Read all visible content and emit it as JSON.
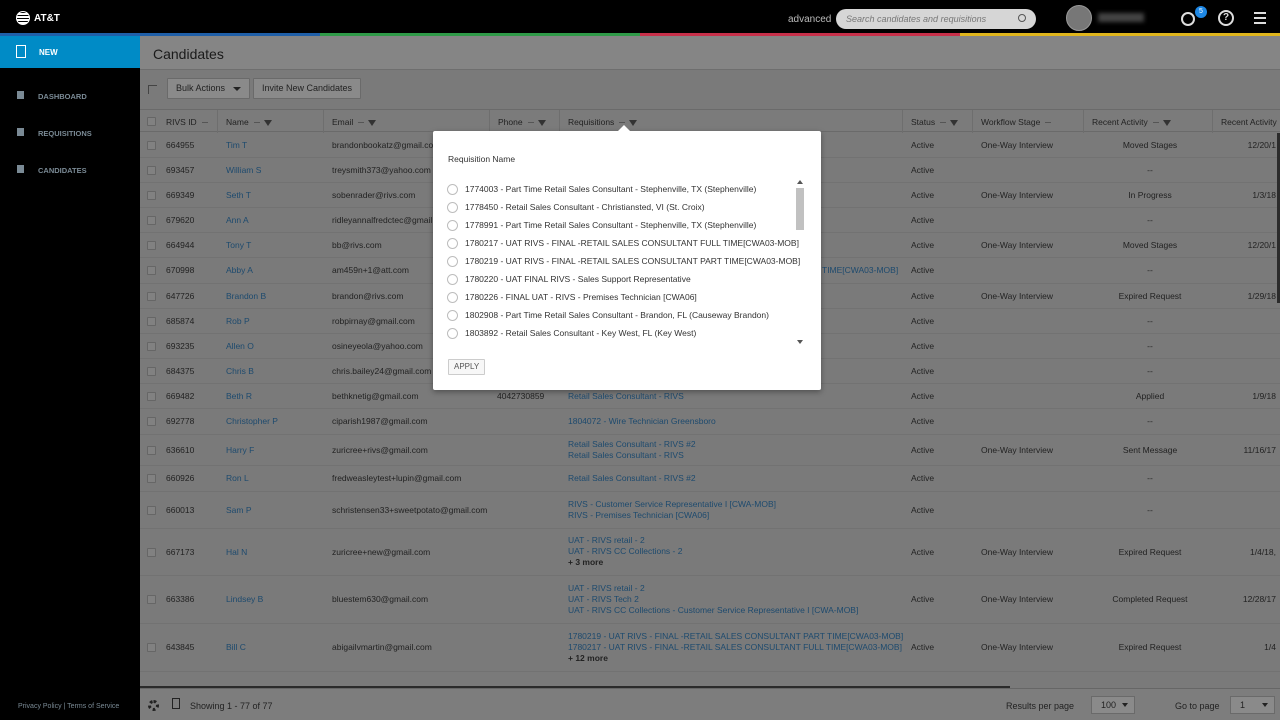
{
  "brand": {
    "name": "AT&T"
  },
  "header": {
    "advanced_label": "advanced",
    "search_placeholder": "Search candidates and requisitions",
    "user_name": "ANGELA",
    "notification_count": "5",
    "strip_colors": [
      "#1f5fa8",
      "#2f9a48",
      "#c8304a",
      "#e0b51c"
    ]
  },
  "sidebar": {
    "items": [
      {
        "label": "NEW",
        "icon": "new-document-icon"
      },
      {
        "label": "DASHBOARD",
        "icon": "bar-chart-icon"
      },
      {
        "label": "REQUISITIONS",
        "icon": "document-stack-icon"
      },
      {
        "label": "CANDIDATES",
        "icon": "person-card-icon"
      }
    ],
    "footer_privacy": "Privacy Policy",
    "footer_sep": " | ",
    "footer_terms": "Terms of Service"
  },
  "page": {
    "title": "Candidates"
  },
  "toolbar": {
    "bulk_actions": "Bulk Actions",
    "invite": "Invite New Candidates"
  },
  "table": {
    "columns": [
      "RIVS ID",
      "Name",
      "Email",
      "Phone",
      "Requisitions",
      "Status",
      "Workflow Stage",
      "Recent Activity",
      "Recent Activity"
    ],
    "rows": [
      {
        "id": "664955",
        "name": "Tim T",
        "email": "brandonbookatz@gmail.com",
        "phone": "",
        "reqs": [],
        "more": "",
        "status": "Active",
        "stage": "One-Way Interview",
        "activity": "Moved Stages",
        "date": "12/20/1"
      },
      {
        "id": "693457",
        "name": "William S",
        "email": "treysmith373@yahoo.com",
        "phone": "",
        "reqs": [],
        "more": "",
        "status": "Active",
        "stage": "",
        "activity": "--",
        "date": ""
      },
      {
        "id": "669349",
        "name": "Seth T",
        "email": "sobenrader@rivs.com",
        "phone": "",
        "reqs": [],
        "more": "",
        "status": "Active",
        "stage": "One-Way Interview",
        "activity": "In Progress",
        "date": "1/3/18"
      },
      {
        "id": "679620",
        "name": "Ann A",
        "email": "ridleyannalfredctec@gmail.com",
        "phone": "",
        "reqs": [],
        "more": "",
        "status": "Active",
        "stage": "",
        "activity": "--",
        "date": ""
      },
      {
        "id": "664944",
        "name": "Tony T",
        "email": "bb@rivs.com",
        "phone": "",
        "reqs": [],
        "more": "",
        "status": "Active",
        "stage": "One-Way Interview",
        "activity": "Moved Stages",
        "date": "12/20/1"
      },
      {
        "id": "670998",
        "name": "Abby A",
        "email": "am459n+1@att.com",
        "phone": "",
        "reqs": [
          "TIME[CWA03-MOB]"
        ],
        "more": "",
        "status": "Active",
        "stage": "",
        "activity": "--",
        "date": ""
      },
      {
        "id": "647726",
        "name": "Brandon B",
        "email": "brandon@rivs.com",
        "phone": "",
        "reqs": [],
        "more": "",
        "status": "Active",
        "stage": "One-Way Interview",
        "activity": "Expired Request",
        "date": "1/29/18"
      },
      {
        "id": "685874",
        "name": "Rob P",
        "email": "robpirnay@gmail.com",
        "phone": "",
        "reqs": [],
        "more": "",
        "status": "Active",
        "stage": "",
        "activity": "--",
        "date": ""
      },
      {
        "id": "693235",
        "name": "Allen O",
        "email": "osineyeola@yahoo.com",
        "phone": "",
        "reqs": [],
        "more": "",
        "status": "Active",
        "stage": "",
        "activity": "--",
        "date": ""
      },
      {
        "id": "684375",
        "name": "Chris B",
        "email": "chris.bailey24@gmail.com",
        "phone": "",
        "reqs": [],
        "more": "",
        "status": "Active",
        "stage": "",
        "activity": "--",
        "date": ""
      },
      {
        "id": "669482",
        "name": "Beth R",
        "email": "bethknetig@gmail.com",
        "phone": "4042730859",
        "reqs": [
          "Retail Sales Consultant - RIVS"
        ],
        "more": "",
        "status": "Active",
        "stage": "",
        "activity": "Applied",
        "date": "1/9/18"
      },
      {
        "id": "692778",
        "name": "Christopher P",
        "email": "ciparish1987@gmail.com",
        "phone": "",
        "reqs": [
          "1804072 - Wire Technician Greensboro"
        ],
        "more": "",
        "status": "Active",
        "stage": "",
        "activity": "--",
        "date": ""
      },
      {
        "id": "636610",
        "name": "Harry F",
        "email": "zuricree+rivs@gmail.com",
        "phone": "",
        "reqs": [
          "Retail Sales Consultant - RIVS #2",
          "Retail Sales Consultant - RIVS"
        ],
        "more": "",
        "status": "Active",
        "stage": "One-Way Interview",
        "activity": "Sent Message",
        "date": "11/16/17"
      },
      {
        "id": "660926",
        "name": "Ron L",
        "email": "fredweasleytest+lupin@gmail.com",
        "phone": "",
        "reqs": [
          "Retail Sales Consultant - RIVS #2"
        ],
        "more": "",
        "status": "Active",
        "stage": "",
        "activity": "--",
        "date": ""
      },
      {
        "id": "660013",
        "name": "Sam P",
        "email": "schristensen33+sweetpotato@gmail.com",
        "phone": "",
        "reqs": [
          "RIVS - Customer Service Representative I [CWA-MOB]",
          "RIVS - Premises Technician [CWA06]"
        ],
        "more": "",
        "status": "Active",
        "stage": "",
        "activity": "--",
        "date": ""
      },
      {
        "id": "667173",
        "name": "Hal N",
        "email": "zuricree+new@gmail.com",
        "phone": "",
        "reqs": [
          "UAT - RIVS retail - 2",
          "UAT - RIVS CC Collections - 2"
        ],
        "more": "+ 3 more",
        "status": "Active",
        "stage": "One-Way Interview",
        "activity": "Expired Request",
        "date": "1/4/18,"
      },
      {
        "id": "663386",
        "name": "Lindsey B",
        "email": "bluestem630@gmail.com",
        "phone": "",
        "reqs": [
          "UAT - RIVS retail - 2",
          "UAT - RIVS Tech 2",
          "UAT - RIVS CC Collections - Customer Service Representative I [CWA-MOB]"
        ],
        "more": "",
        "status": "Active",
        "stage": "One-Way Interview",
        "activity": "Completed Request",
        "date": "12/28/17"
      },
      {
        "id": "643845",
        "name": "Bill C",
        "email": "abigailvmartin@gmail.com",
        "phone": "",
        "reqs": [
          "1780219 - UAT RIVS - FINAL -RETAIL SALES CONSULTANT PART TIME[CWA03-MOB]",
          "1780217 - UAT RIVS - FINAL -RETAIL SALES CONSULTANT FULL TIME[CWA03-MOB]"
        ],
        "more": "+ 12 more",
        "status": "Active",
        "stage": "One-Way Interview",
        "activity": "Expired Request",
        "date": "1/4"
      }
    ]
  },
  "footer": {
    "showing": "Showing 1 - 77 of 77",
    "results_per_page_label": "Results per page",
    "results_per_page_value": "100",
    "go_to_page_label": "Go to page",
    "go_to_page_value": "1"
  },
  "modal": {
    "title": "Requisition Name",
    "options": [
      "1774003 - Part Time Retail Sales Consultant - Stephenville, TX (Stephenville)",
      "1778450 - Retail Sales Consultant - Christiansted, VI (St. Croix)",
      "1778991 - Part Time Retail Sales Consultant - Stephenville, TX (Stephenville)",
      "1780217 - UAT RIVS - FINAL -RETAIL SALES CONSULTANT FULL TIME[CWA03-MOB]",
      "1780219 - UAT RIVS - FINAL -RETAIL SALES CONSULTANT PART TIME[CWA03-MOB]",
      "1780220 - UAT FINAL RIVS - Sales Support Representative",
      "1780226 - FINAL UAT - RIVS - Premises Technician [CWA06]",
      "1802908 - Part Time Retail Sales Consultant - Brandon, FL (Causeway Brandon)",
      "1803892 - Retail Sales Consultant - Key West, FL (Key West)"
    ],
    "apply_label": "APPLY"
  }
}
